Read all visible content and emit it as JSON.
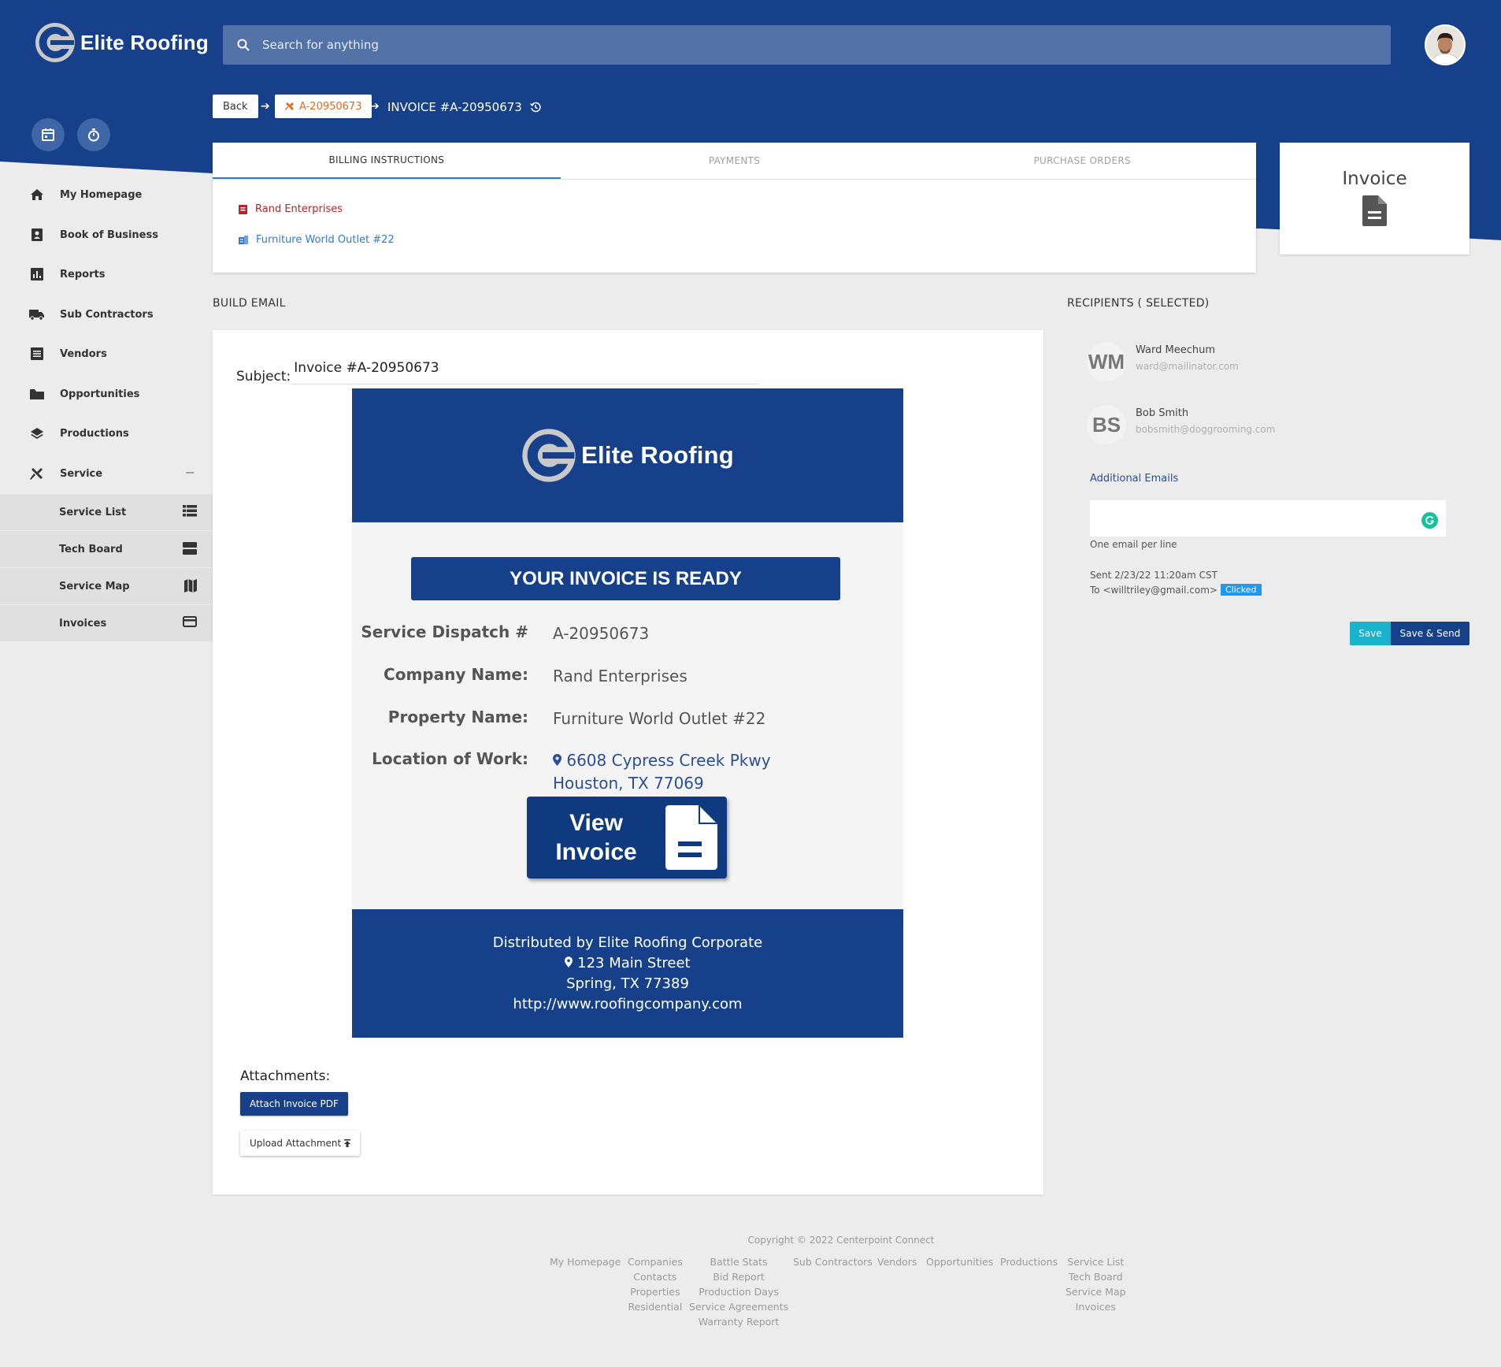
{
  "app": {
    "name": "Elite Roofing",
    "search_placeholder": "Search for anything"
  },
  "sidebar": {
    "items": [
      {
        "label": "My Homepage",
        "icon": "home-icon"
      },
      {
        "label": "Book of Business",
        "icon": "contact-book-icon"
      },
      {
        "label": "Reports",
        "icon": "bar-chart-icon"
      },
      {
        "label": "Sub Contractors",
        "icon": "truck-icon"
      },
      {
        "label": "Vendors",
        "icon": "list-box-icon"
      },
      {
        "label": "Opportunities",
        "icon": "folder-icon"
      },
      {
        "label": "Productions",
        "icon": "layers-icon"
      },
      {
        "label": "Service",
        "icon": "tools-icon",
        "expanded_indicator": "−"
      }
    ],
    "service_subitems": [
      {
        "label": "Service List",
        "icon": "list-icon"
      },
      {
        "label": "Tech Board",
        "icon": "board-icon"
      },
      {
        "label": "Service Map",
        "icon": "map-icon"
      },
      {
        "label": "Invoices",
        "icon": "credit-card-icon"
      }
    ]
  },
  "breadcrumb": {
    "back": "Back",
    "dispatch": "A-20950673",
    "current": "INVOICE #A-20950673"
  },
  "tabs": [
    "BILLING INSTRUCTIONS",
    "PAYMENTS",
    "PURCHASE ORDERS"
  ],
  "billing": {
    "company": "Rand Enterprises",
    "property": "Furniture World Outlet #22"
  },
  "invoice_card": {
    "title": "Invoice"
  },
  "build_email": {
    "heading": "BUILD EMAIL",
    "subject_label": "Subject:",
    "subject_value": "Invoice #A-20950673",
    "preview": {
      "logo_text": "Elite Roofing",
      "banner": "YOUR INVOICE IS READY",
      "rows": [
        {
          "label": "Service Dispatch #",
          "value": "A-20950673"
        },
        {
          "label": "Company Name:",
          "value": "Rand Enterprises"
        },
        {
          "label": "Property Name:",
          "value": "Furniture World Outlet #22"
        },
        {
          "label": "Location of Work:",
          "value_line1": "6608 Cypress Creek Pkwy",
          "value_line2": "Houston, TX 77069"
        }
      ],
      "view_invoice_line1": "View",
      "view_invoice_line2": "Invoice",
      "footer": {
        "line1": "Distributed by Elite Roofing Corporate",
        "line2": "123 Main Street",
        "line3": "Spring, TX 77389",
        "line4": "http://www.roofingcompany.com"
      }
    },
    "attachments_label": "Attachments:",
    "attach_pdf": "Attach Invoice PDF",
    "upload_attachment": "Upload Attachment"
  },
  "recipients": {
    "heading": "RECIPIENTS ( SELECTED)",
    "list": [
      {
        "initials": "WM",
        "name": "Ward Meechum",
        "email": "ward@mailinator.com"
      },
      {
        "initials": "BS",
        "name": "Bob Smith",
        "email": "bobsmith@doggrooming.com"
      }
    ],
    "additional_label": "Additional Emails",
    "additional_value": "",
    "help": "One email per line",
    "sent": "Sent 2/23/22 11:20am CST",
    "to": "To <willtriley@gmail.com>",
    "clicked_badge": "Clicked",
    "save": "Save",
    "save_send": "Save & Send"
  },
  "footer": {
    "copyright": "Copyright © 2022 Centerpoint Connect",
    "col1": [
      "My Homepage"
    ],
    "col2": [
      "Companies",
      "Contacts",
      "Properties",
      "Residential"
    ],
    "col3": [
      "Battle Stats",
      "Bid Report",
      "Production Days",
      "Service Agreements",
      "Warranty Report"
    ],
    "col4": [
      "Sub Contractors"
    ],
    "col5": [
      "Vendors"
    ],
    "col6": [
      "Opportunities"
    ],
    "col7": [
      "Productions"
    ],
    "col8": [
      "Service List",
      "Tech Board",
      "Service Map",
      "Invoices"
    ]
  },
  "colors": {
    "brand_blue": "#16418a",
    "accent_cyan": "#19b3cc",
    "link_blue": "#2f7ad1",
    "company_red": "#b0262a",
    "dispatch_orange": "#e06a1e",
    "clicked_blue": "#2196f3"
  }
}
